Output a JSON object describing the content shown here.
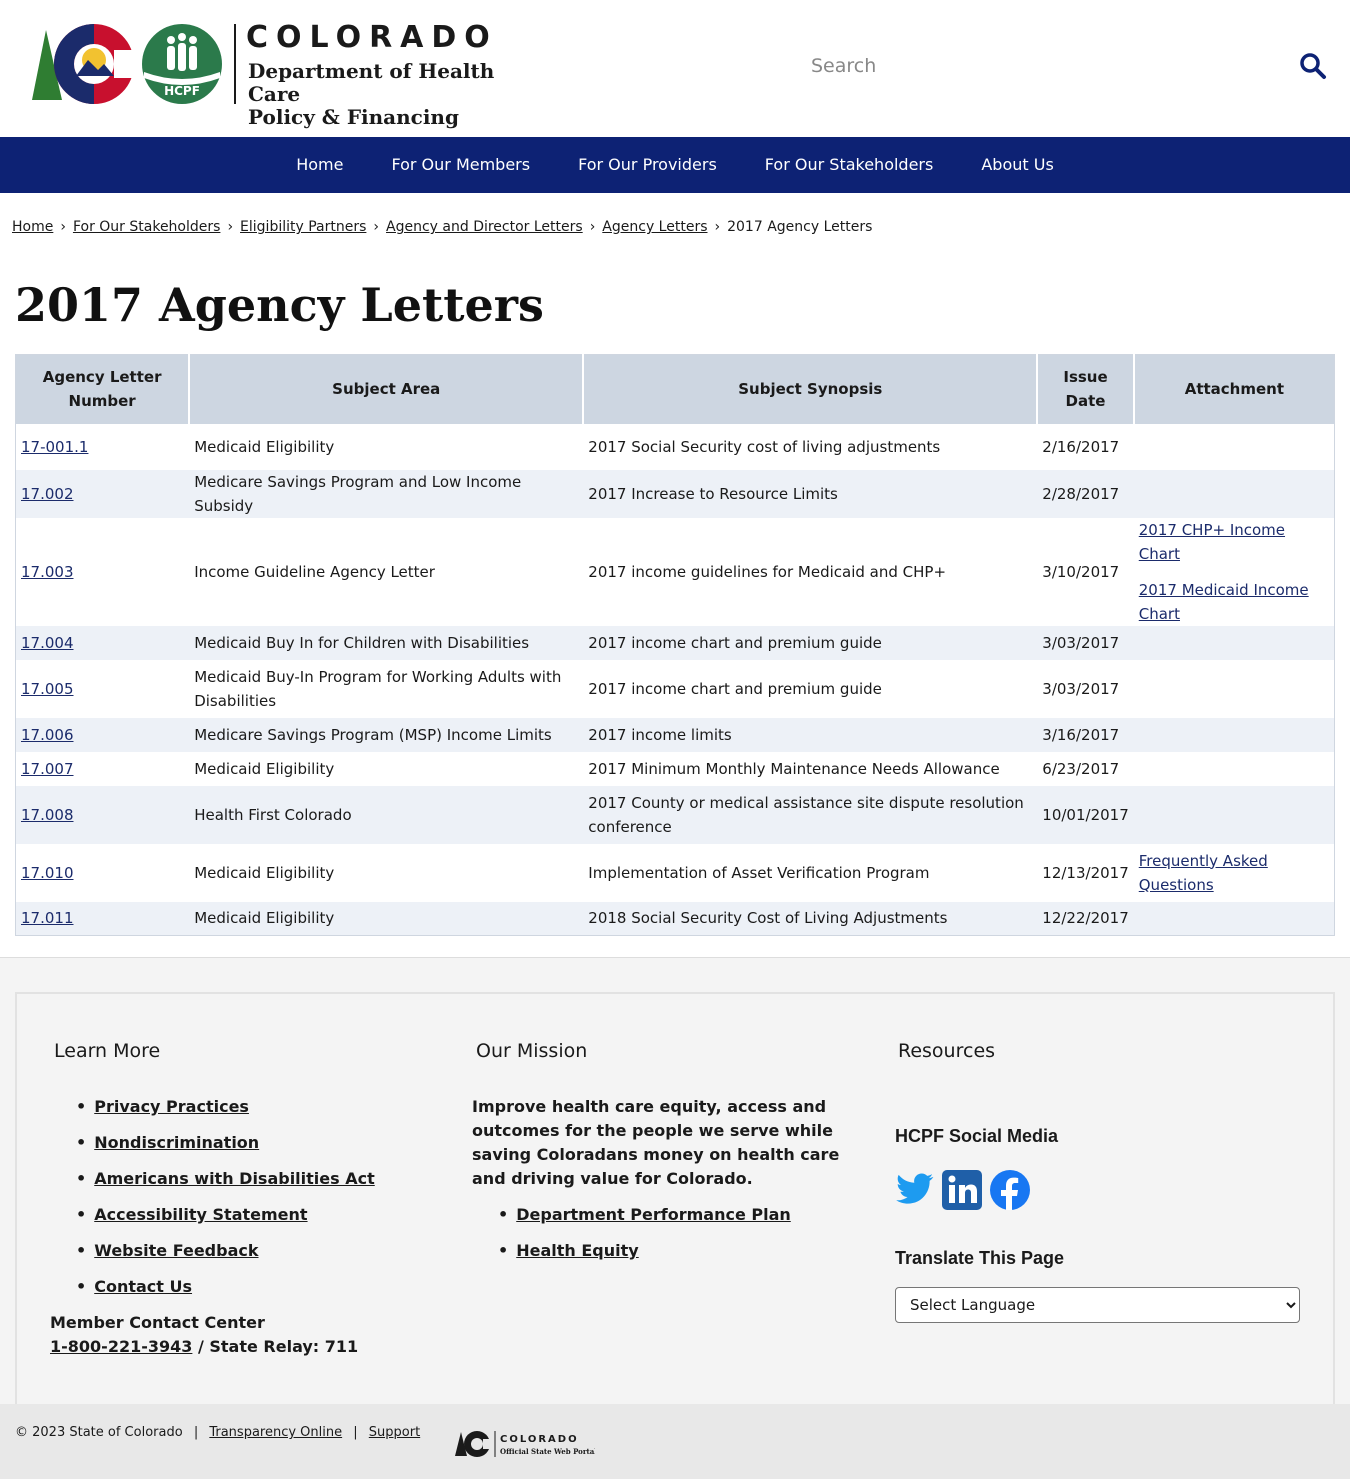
{
  "header": {
    "state_word": "COLORADO",
    "dept_line1": "Department of Health Care",
    "dept_line2": "Policy & Financing",
    "hcpf_badge": "HCPF",
    "search_placeholder": "Search"
  },
  "nav": {
    "items": [
      {
        "label": "Home"
      },
      {
        "label": "For Our Members"
      },
      {
        "label": "For Our Providers"
      },
      {
        "label": "For Our Stakeholders"
      },
      {
        "label": "About Us"
      }
    ]
  },
  "breadcrumb": {
    "links": [
      "Home",
      "For Our Stakeholders",
      "Eligibility Partners",
      "Agency and Director Letters",
      "Agency Letters"
    ],
    "current": "2017 Agency Letters",
    "separator": "›"
  },
  "page_title": "2017 Agency Letters",
  "table": {
    "headers": [
      "Agency Letter Number",
      "Subject Area",
      "Subject Synopsis",
      "Issue Date",
      "Attachment"
    ],
    "rows": [
      {
        "number": "17-001.1",
        "subject": "Medicaid Eligibility",
        "synopsis": "2017 Social Security cost of living adjustments",
        "date": "2/16/2017",
        "attachments": []
      },
      {
        "number": "17.002",
        "subject": "Medicare Savings Program and Low Income Subsidy",
        "synopsis": "2017 Increase to Resource Limits",
        "date": "2/28/2017",
        "attachments": []
      },
      {
        "number": "17.003",
        "subject": "Income Guideline Agency Letter",
        "synopsis": "2017 income guidelines for Medicaid and CHP+",
        "date": "3/10/2017",
        "attachments": [
          "2017 CHP+ Income Chart",
          "2017 Medicaid Income Chart"
        ]
      },
      {
        "number": "17.004",
        "subject": "Medicaid Buy In for Children with Disabilities",
        "synopsis": "2017 income chart and premium guide",
        "date": "3/03/2017",
        "attachments": []
      },
      {
        "number": "17.005",
        "subject": "Medicaid Buy-In Program for Working Adults with Disabilities",
        "synopsis": "2017 income chart and premium guide",
        "date": "3/03/2017",
        "attachments": []
      },
      {
        "number": "17.006",
        "subject": "Medicare Savings Program (MSP) Income Limits",
        "synopsis": "2017 income limits",
        "date": "3/16/2017",
        "attachments": []
      },
      {
        "number": "17.007",
        "subject": "Medicaid Eligibility",
        "synopsis": "2017 Minimum Monthly Maintenance Needs Allowance",
        "date": "6/23/2017",
        "attachments": []
      },
      {
        "number": "17.008",
        "subject": "Health First Colorado",
        "synopsis": "2017 County or medical assistance site dispute resolution conference",
        "date": "10/01/2017",
        "attachments": []
      },
      {
        "number": "17.010",
        "subject": "Medicaid Eligibility",
        "synopsis": "Implementation of Asset Verification Program",
        "date": "12/13/2017",
        "attachments": [
          "Frequently Asked Questions"
        ]
      },
      {
        "number": "17.011",
        "subject": "Medicaid Eligibility",
        "synopsis": "2018 Social Security Cost of Living Adjustments",
        "date": "12/22/2017",
        "attachments": []
      }
    ]
  },
  "footer": {
    "learn_more": {
      "title": "Learn More",
      "links": [
        "Privacy Practices",
        "Nondiscrimination",
        "Americans with Disabilities Act",
        "Accessibility Statement",
        "Website Feedback",
        "Contact Us"
      ],
      "contact_label": "Member Contact Center",
      "phone": "1-800-221-3943",
      "relay": " / State Relay: 711"
    },
    "mission": {
      "title": "Our Mission",
      "text": "Improve health care equity, access and outcomes for the people we serve while saving Coloradans money on health care and driving value for Colorado.",
      "links": [
        "Department Performance Plan",
        "Health Equity"
      ]
    },
    "resources": {
      "title": "Resources",
      "social_title": "HCPF Social Media",
      "social_icons": [
        "twitter-icon",
        "linkedin-icon",
        "facebook-icon"
      ],
      "translate_title": "Translate This Page",
      "language_selected": "Select Language"
    }
  },
  "bottom": {
    "copyright": "© 2023 State of Colorado",
    "links": [
      "Transparency Online",
      "Support"
    ],
    "separator": "|",
    "portal_word": "COLORADO",
    "portal_sub": "Official State Web Portal"
  },
  "colors": {
    "nav_bg": "#0d2274",
    "header_row": "#cdd6e1",
    "row_alt": "#edf1f7",
    "link": "#1b2b6b",
    "footer_bg": "#f4f4f4",
    "search_icon": "#0d2274"
  }
}
